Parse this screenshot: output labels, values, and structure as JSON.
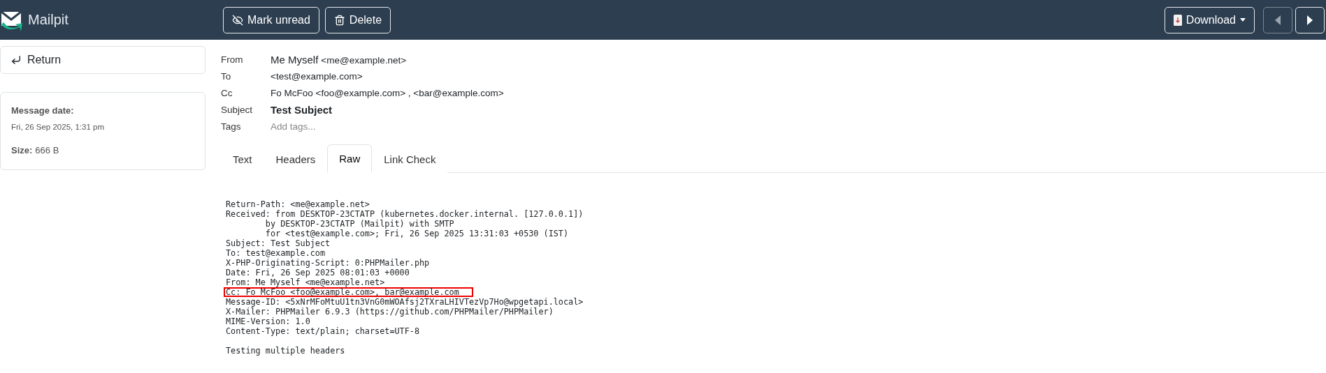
{
  "app": {
    "name": "Mailpit"
  },
  "toolbar": {
    "buttons": [
      {
        "label": "Mark unread",
        "kind": "mark"
      },
      {
        "label": "Delete",
        "kind": "delete"
      }
    ],
    "download": {
      "label": "Download"
    },
    "nav": [
      {
        "kind": "prev",
        "disabled": true
      },
      {
        "kind": "next",
        "disabled": false
      }
    ]
  },
  "sidebar": {
    "return_label": "Return",
    "info": [
      {
        "label": "Message date:",
        "value": "Fri, 26 Sep 2025, 1:31 pm",
        "kind": "block"
      },
      {
        "label": "Size:",
        "value": "666 B",
        "kind": "inline"
      }
    ]
  },
  "headers": [
    {
      "label": "From",
      "name": "Me Myself",
      "address": "<me@example.net>",
      "kind": "contact"
    },
    {
      "label": "To",
      "value": "<test@example.com>",
      "kind": "plain"
    },
    {
      "label": "Cc",
      "value": "Fo McFoo <foo@example.com> , <bar@example.com>",
      "kind": "plain"
    },
    {
      "label": "Subject",
      "value": "Test Subject",
      "kind": "subject"
    },
    {
      "label": "Tags",
      "placeholder": "Add tags...",
      "kind": "tags"
    }
  ],
  "tabs": [
    {
      "label": "Text",
      "selected": false
    },
    {
      "label": "Headers",
      "selected": false
    },
    {
      "label": "Raw",
      "selected": true
    },
    {
      "label": "Link Check",
      "selected": false
    }
  ],
  "raw_lines": [
    {
      "text": "Return-Path: <me@example.net>",
      "highlighted": false
    },
    {
      "text": "Received: from DESKTOP-23CTATP (kubernetes.docker.internal. [127.0.0.1])",
      "highlighted": false
    },
    {
      "text": "        by DESKTOP-23CTATP (Mailpit) with SMTP",
      "highlighted": false
    },
    {
      "text": "        for <test@example.com>; Fri, 26 Sep 2025 13:31:03 +0530 (IST)",
      "highlighted": false
    },
    {
      "text": "Subject: Test Subject",
      "highlighted": false
    },
    {
      "text": "To: test@example.com",
      "highlighted": false
    },
    {
      "text": "X-PHP-Originating-Script: 0:PHPMailer.php",
      "highlighted": false
    },
    {
      "text": "Date: Fri, 26 Sep 2025 08:01:03 +0000",
      "highlighted": false
    },
    {
      "text": "From: Me Myself <me@example.net>",
      "highlighted": false
    },
    {
      "text": "Cc: Fo McFoo <foo@example.com>, bar@example.com",
      "highlighted": true
    },
    {
      "text": "Message-ID: <5xNrMFoMtuU1tn3VnG0mWOAfsj2TXraLHIVTezVp7Ho@wpgetapi.local>",
      "highlighted": false
    },
    {
      "text": "X-Mailer: PHPMailer 6.9.3 (https://github.com/PHPMailer/PHPMailer)",
      "highlighted": false
    },
    {
      "text": "MIME-Version: 1.0",
      "highlighted": false
    },
    {
      "text": "Content-Type: text/plain; charset=UTF-8",
      "highlighted": false
    },
    {
      "text": "Testing multiple headers",
      "highlighted": false,
      "kind": "body"
    }
  ]
}
